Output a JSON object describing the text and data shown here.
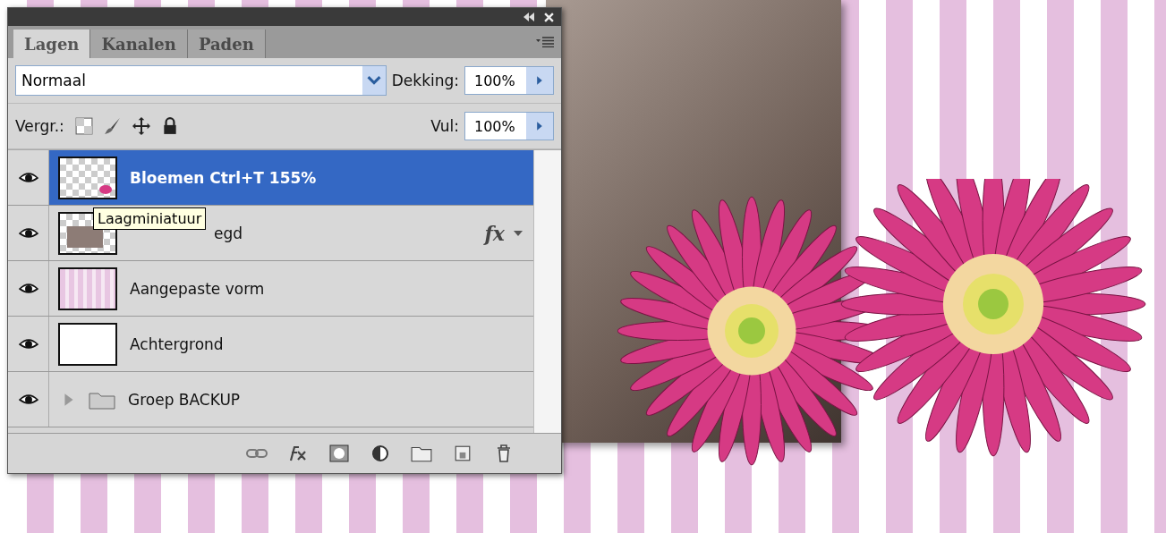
{
  "panel": {
    "tabs": [
      {
        "label": "Lagen",
        "selected": true
      },
      {
        "label": "Kanalen",
        "selected": false
      },
      {
        "label": "Paden",
        "selected": false
      }
    ],
    "blend_mode": {
      "value": "Normaal"
    },
    "opacity": {
      "label": "Dekking:",
      "value": "100%"
    },
    "lock": {
      "label": "Vergr.:"
    },
    "fill": {
      "label": "Vul:",
      "value": "100%"
    },
    "layers": [
      {
        "kind": "layer",
        "name": "Bloemen Ctrl+T 155%",
        "visible": true,
        "selected": true,
        "thumbnail": {
          "kind": "checker-flower"
        }
      },
      {
        "kind": "layer",
        "name": "egd",
        "visible": true,
        "selected": false,
        "thumbnail": {
          "kind": "checker-photo"
        },
        "effects": "fx"
      },
      {
        "kind": "layer",
        "name": "Aangepaste vorm",
        "visible": true,
        "selected": false,
        "thumbnail": {
          "kind": "stripes"
        }
      },
      {
        "kind": "layer",
        "name": "Achtergrond",
        "visible": true,
        "selected": false,
        "thumbnail": {
          "kind": "white"
        }
      },
      {
        "kind": "group",
        "name": "Groep BACKUP",
        "visible": true,
        "selected": false,
        "expanded": false
      }
    ],
    "tooltip": "Laagminiatuur"
  }
}
